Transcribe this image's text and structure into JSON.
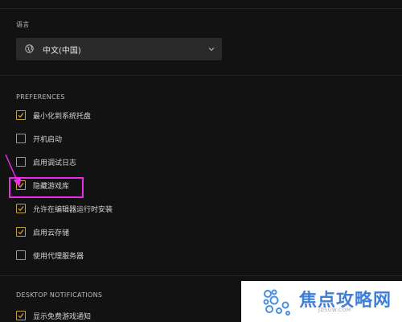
{
  "language": {
    "section_label": "语言",
    "selected": "中文(中国)"
  },
  "preferences": {
    "section_label": "PREFERENCES",
    "options": [
      {
        "label": "最小化到系统托盘",
        "checked": true
      },
      {
        "label": "开机启动",
        "checked": false
      },
      {
        "label": "启用调试日志",
        "checked": false
      },
      {
        "label": "隐藏游戏库",
        "checked": true
      },
      {
        "label": "允许在编辑器运行时安装",
        "checked": true
      },
      {
        "label": "启用云存储",
        "checked": true
      },
      {
        "label": "使用代理服务器",
        "checked": false
      }
    ]
  },
  "notifications": {
    "section_label": "DESKTOP NOTIFICATIONS",
    "first_option": {
      "label": "显示免费游戏通知",
      "checked": true
    }
  },
  "annotation": {
    "color": "#ea2bea"
  },
  "colors": {
    "accent": "#c5a03c",
    "background": "#121212",
    "dropdown": "#2a2a2a"
  },
  "watermark": {
    "brand": "焦点攻略网",
    "url": "JDSGW.COM"
  }
}
